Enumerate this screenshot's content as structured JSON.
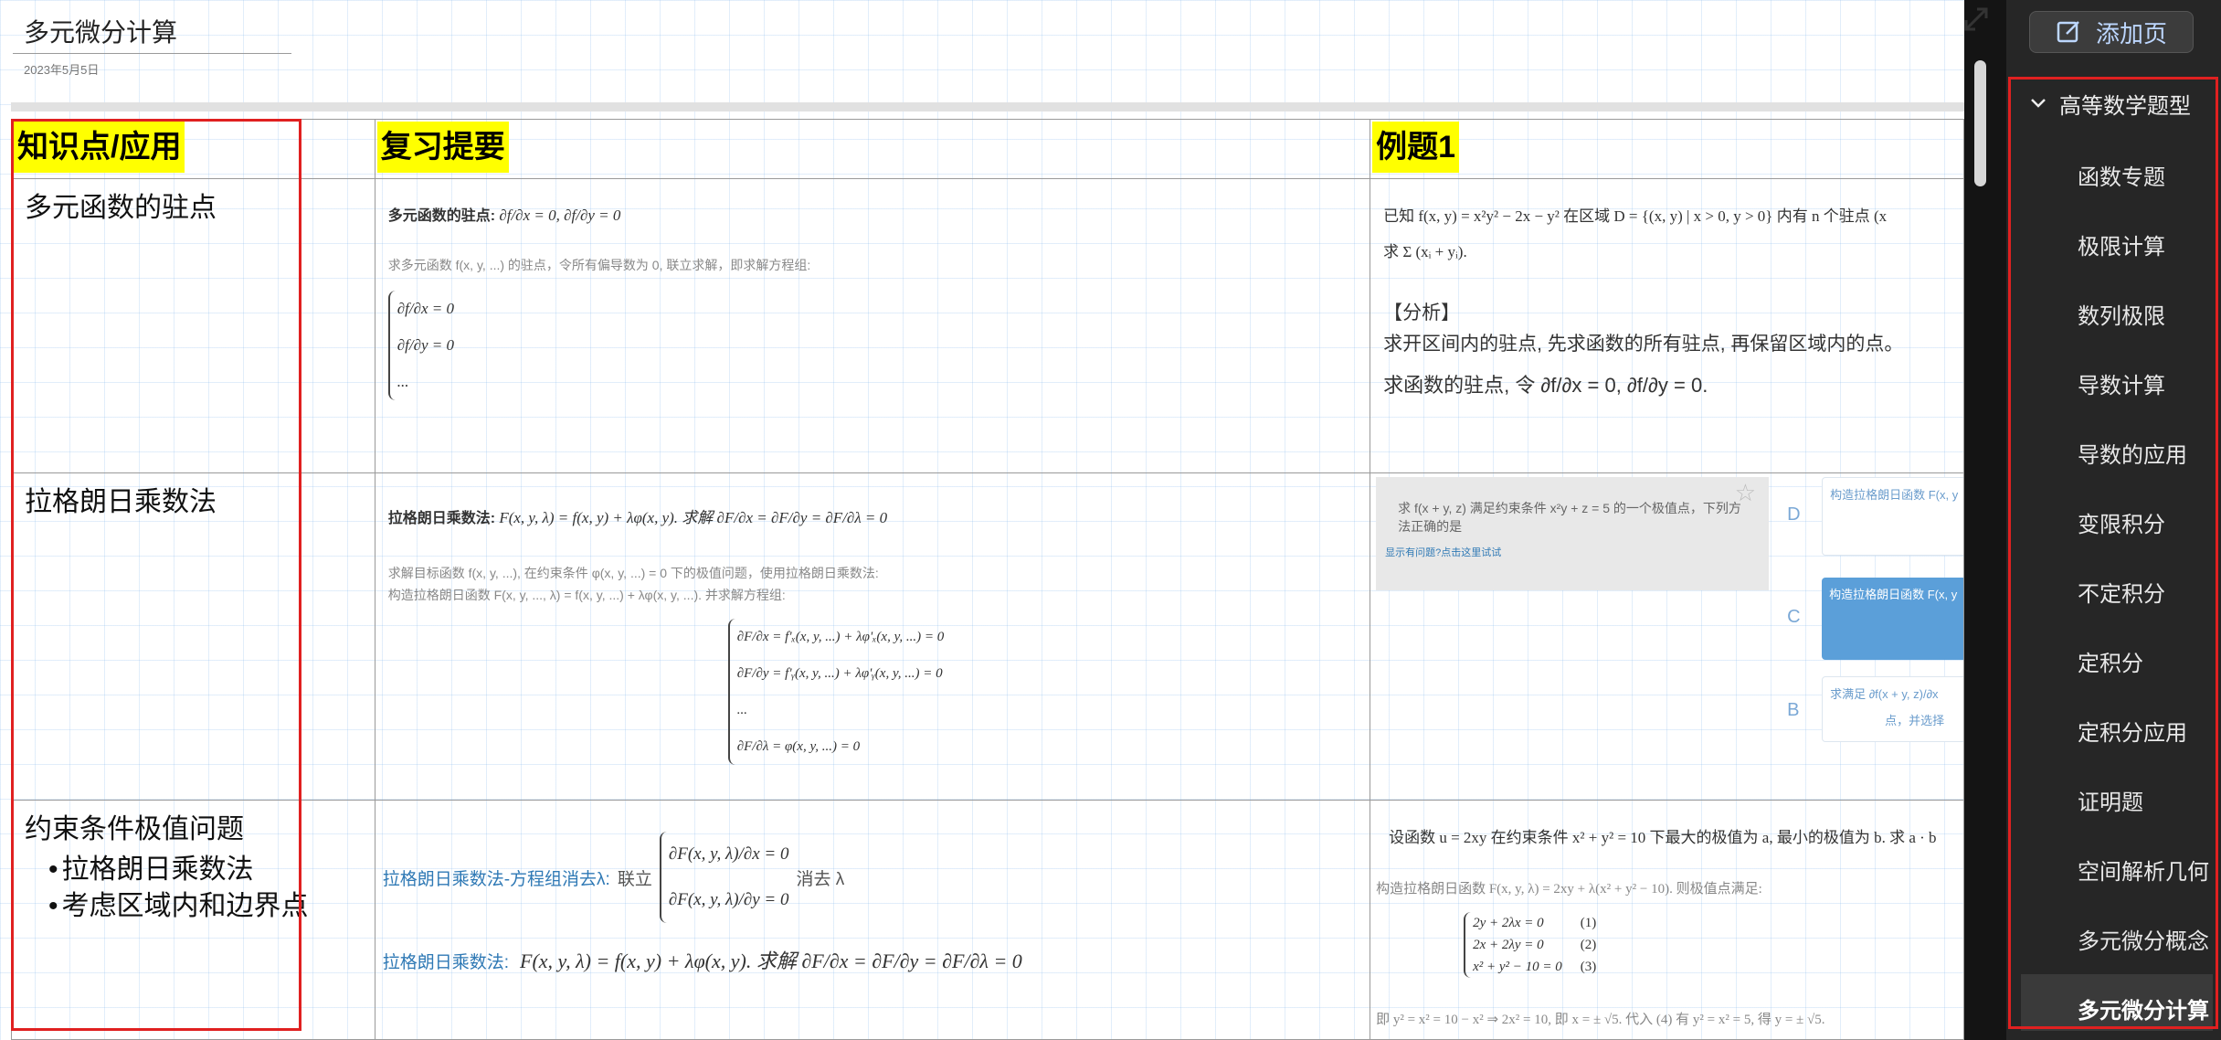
{
  "page": {
    "title": "多元微分计算",
    "date": "2023年5月5日"
  },
  "table": {
    "headers": [
      "知识点/应用",
      "复习提要",
      "例题1"
    ],
    "rows": [
      {
        "topic": "多元函数的驻点",
        "review_title": "多元函数的驻点:",
        "review_eq": "∂f/∂x = 0, ∂f/∂y = 0",
        "review_note": "求多元函数 f(x, y, ...) 的驻点，令所有偏导数为 0, 联立求解，即求解方程组:",
        "review_sys": [
          "∂f/∂x = 0",
          "∂f/∂y = 0",
          "..."
        ],
        "example_q1": "已知 f(x, y) = x²y² − 2x − y² 在区域 D = {(x, y) | x > 0, y > 0} 内有 n 个驻点 (x",
        "example_q2": "求 Σ (xᵢ + yᵢ).",
        "example_analysis": "【分析】",
        "example_a1": "求开区间内的驻点, 先求函数的所有驻点, 再保留区域内的点。",
        "example_a2": "求函数的驻点, 令 ∂f/∂x = 0, ∂f/∂y = 0."
      },
      {
        "topic": "拉格朗日乘数法",
        "review_title": "拉格朗日乘数法:",
        "review_eq": "F(x, y, λ) = f(x, y) + λφ(x, y). 求解 ∂F/∂x = ∂F/∂y = ∂F/∂λ = 0",
        "review_note1": "求解目标函数 f(x, y, ...), 在约束条件 φ(x, y, ...) = 0 下的极值问题，使用拉格朗日乘数法:",
        "review_note2": "构造拉格朗日函数 F(x, y, ..., λ) = f(x, y, ...) + λφ(x, y, ...). 并求解方程组:",
        "review_sys": [
          "∂F/∂x = f'ₓ(x, y, ...) + λφ'ₓ(x, y, ...) = 0",
          "∂F/∂y = f'ᵧ(x, y, ...) + λφ'ᵧ(x, y, ...) = 0",
          "...",
          "∂F/∂λ = φ(x, y, ...) = 0"
        ],
        "quiz_q": "求 f(x + y, z) 满足约束条件 x²y + z = 5 的一个极值点，下列方法正确的是",
        "quiz_link": "显示有问题?点击这里试试",
        "quiz_opt_d_label": "D",
        "quiz_opt_d_text": "构造拉格朗日函数 F(x, y",
        "quiz_opt_c_label": "C",
        "quiz_opt_c_text": "构造拉格朗日函数 F(x, y",
        "quiz_opt_b_label": "B",
        "quiz_opt_b_text1": "求满足 ∂f(x + y, z)/∂x",
        "quiz_opt_b_text2": "点，并选择"
      },
      {
        "topic": "约束条件极值问题",
        "topic_bullets": [
          "拉格朗日乘数法",
          "考虑区域内和边界点"
        ],
        "review_blue1": "拉格朗日乘数法-方程组消去λ:",
        "review_text1": "联立",
        "review_sys": [
          "∂F(x, y, λ)/∂x = 0",
          "∂F(x, y, λ)/∂y = 0"
        ],
        "review_text1b": "消去 λ",
        "review_blue2": "拉格朗日乘数法:",
        "review_eq2": "F(x, y, λ) = f(x, y) + λφ(x, y). 求解 ∂F/∂x = ∂F/∂y = ∂F/∂λ = 0",
        "example_q": "设函数 u = 2xy 在约束条件 x² + y² = 10 下最大的极值为 a, 最小的极值为 b. 求 a · b",
        "example_l1": "构造拉格朗日函数 F(x, y, λ) = 2xy + λ(x² + y² − 10). 则极值点满足:",
        "example_sys": [
          "2y + 2λx = 0",
          "2x + 2λy = 0",
          "x² + y² − 10 = 0"
        ],
        "example_sys_tags": [
          "(1)",
          "(2)",
          "(3)"
        ],
        "example_l2": "即 y² = x² = 10 − x² ⇒ 2x² = 10, 即 x = ± √5. 代入 (4) 有 y² = x² = 5, 得 y = ± √5."
      }
    ]
  },
  "sidebar": {
    "add_page_label": "添加页",
    "group_label": "高等数学题型",
    "items": [
      "函数专题",
      "极限计算",
      "数列极限",
      "导数计算",
      "导数的应用",
      "变限积分",
      "不定积分",
      "定积分",
      "定积分应用",
      "证明题",
      "空间解析几何",
      "多元微分概念",
      "多元微分计算"
    ],
    "active_index": 12
  },
  "colors": {
    "highlight": "#ffff00",
    "annotation_red": "#e02020",
    "sidebar_bg": "#262626",
    "link_blue": "#2f79b5"
  }
}
